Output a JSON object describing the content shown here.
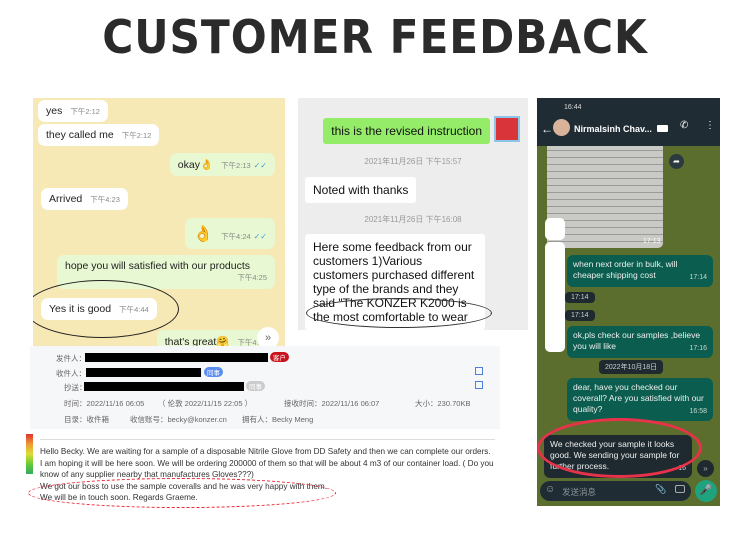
{
  "title": "CUSTOMER FEEDBACK",
  "panel1": {
    "messages": [
      {
        "text": "yes",
        "time": "下午2:12",
        "from": "them"
      },
      {
        "text": "they called me",
        "time": "下午2:12",
        "from": "them"
      },
      {
        "text": "okay👌",
        "time": "下午2:13",
        "from": "me"
      },
      {
        "text": "Arrived",
        "time": "下午4:23",
        "from": "them"
      },
      {
        "text": "👌",
        "time": "下午4:24",
        "from": "me"
      },
      {
        "text": "hope you will satisfied with our products",
        "time": "下午4:25",
        "from": "me"
      },
      {
        "text": "Yes it is good",
        "time": "下午4:44",
        "from": "them"
      },
      {
        "text": "that's great🤗",
        "time": "下午4:59",
        "from": "me"
      }
    ],
    "tick": "✓✓"
  },
  "panel2": {
    "messages": [
      {
        "text": "this is the revised instruction",
        "from": "me"
      },
      {
        "timestamp": "2021年11月26日 下午15:57"
      },
      {
        "text": "Noted with thanks",
        "from": "them"
      },
      {
        "timestamp": "2021年11月26日 下午16:08"
      },
      {
        "text": "Here some feedback from our customers 1)Various customers purchased different type of the brands and they said \"The KONZER K2000 is the most comfortable to wear",
        "from": "them"
      }
    ]
  },
  "panel3": {
    "status_time": "16:44",
    "contact": "Nirmalsinh Chav...",
    "photo_time": "17:13",
    "messages": [
      {
        "text": "when next order in bulk, will cheaper shipping  cost",
        "time": "17:14"
      },
      {
        "text": "",
        "time": "17:14"
      },
      {
        "text": "",
        "time": "17:14"
      },
      {
        "text": "ok,pls check our samples ,believe you will like",
        "time": "17:16"
      },
      {
        "date": "2022年10月18日"
      },
      {
        "text": "dear, have you checked our coverall? Are you satisfied with our quality?",
        "time": "16:58"
      },
      {
        "text": "We checked your sample it looks good. We sending your sample for further process.",
        "time": "16"
      }
    ],
    "input_placeholder": "发送消息",
    "colors": {
      "bubble": "#0b5e4f",
      "bg": "#5b6e2e",
      "mic": "#1fa37e"
    }
  },
  "email": {
    "from_label": "发件人：",
    "from_badge": "客户",
    "to_label": "收件人：",
    "to_badge": "同事",
    "cc_label": "抄送：",
    "cc_badge": "同事",
    "time": "时间：2022/11/16 06:05",
    "sent_note": "（ 伦敦 2022/11/15 22:05 ）",
    "received": "接收时间：2022/11/16 06:07",
    "size": "大小：230.70KB",
    "folder": "目录：收件箱",
    "account": "收信账号：becky@konzer.cn",
    "owner": "拥有人：Becky Meng",
    "body": [
      "Hello Becky. We are waiting for a sample of a disposable Nitrile Glove from DD Safety and then we can complete our orders. I am hoping it will be here soon. We will be ordering 200000 of them so that will be about 4 m3 of our container load. ( Do you know of any supplier nearby that manufactures Gloves???)",
      "We got our boss to use the sample coveralls and he was very happy with them.",
      "We will be in touch soon. Regards Graeme."
    ]
  }
}
